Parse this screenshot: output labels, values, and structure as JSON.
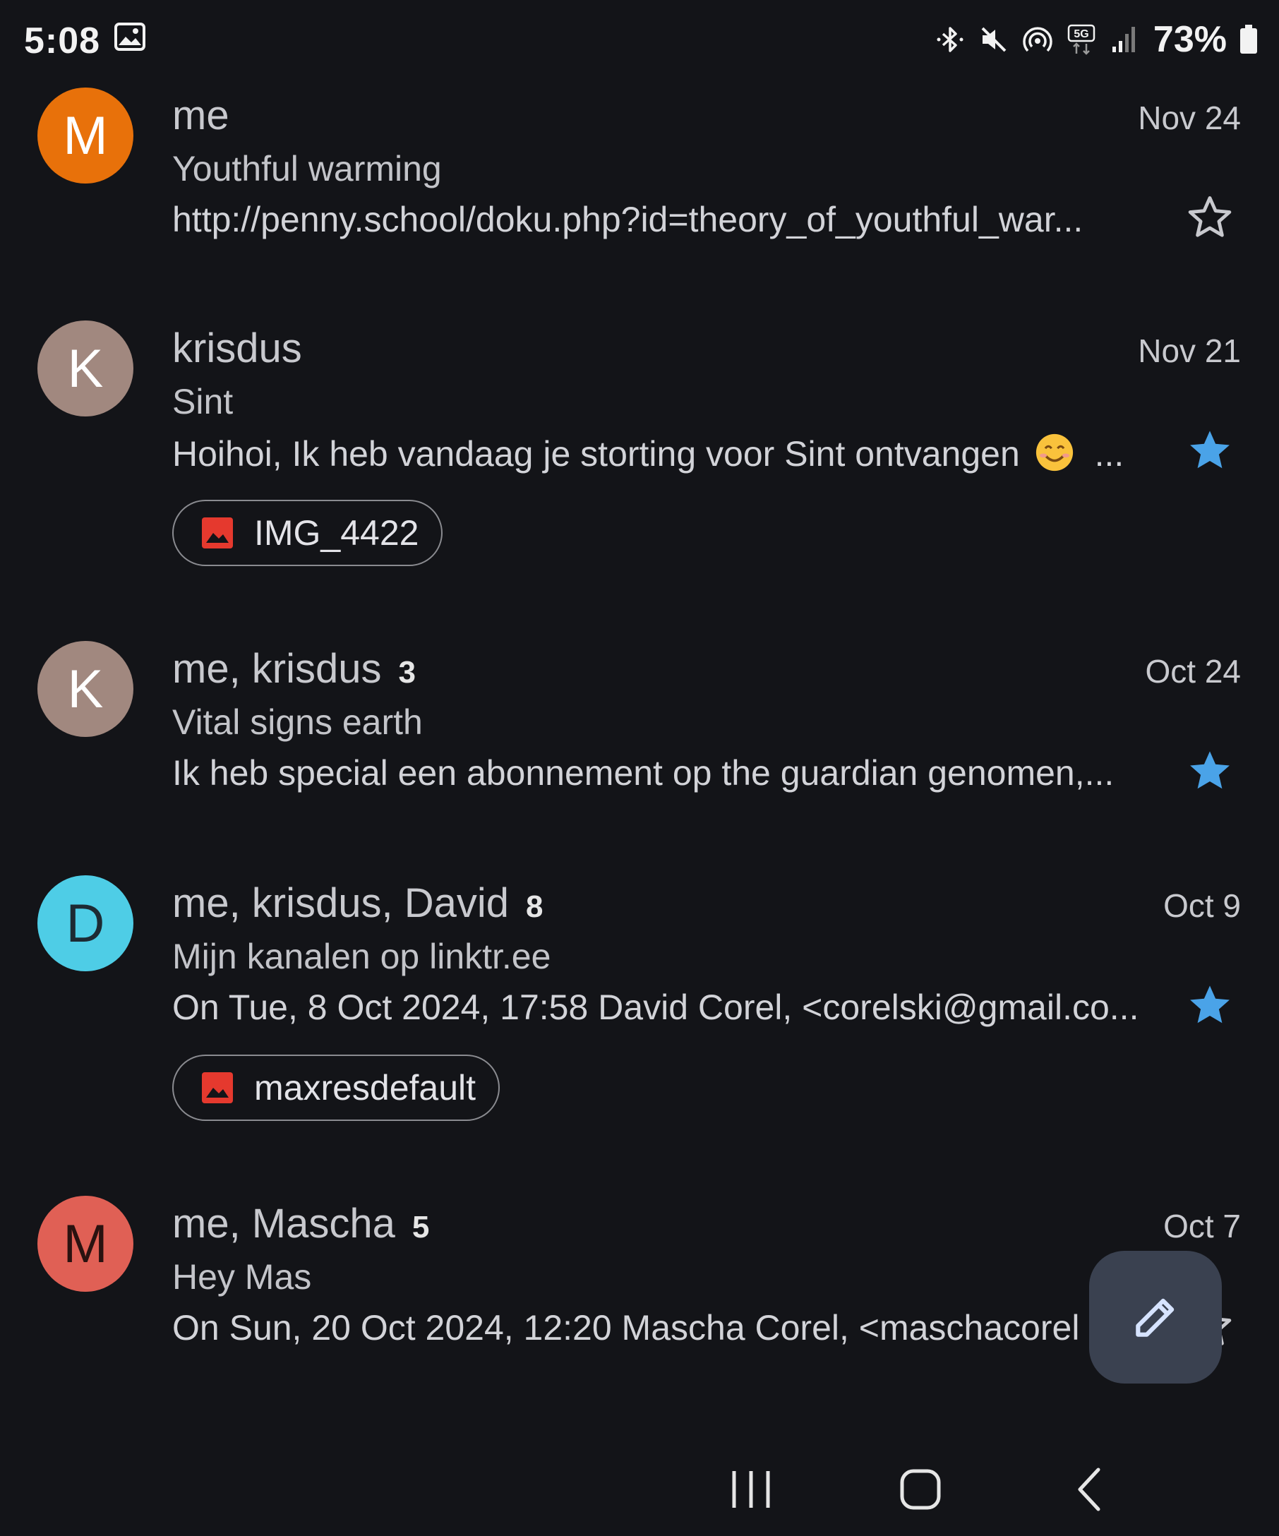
{
  "status_bar": {
    "time": "5:08",
    "battery_percent": "73%",
    "icons": [
      "gallery-icon",
      "bluetooth-icon",
      "mute-icon",
      "hotspot-icon",
      "5g-icon",
      "signal-icon",
      "battery-icon"
    ]
  },
  "mails": [
    {
      "avatar_letter": "M",
      "avatar_color": "#e8710a",
      "sender": "me",
      "count": "",
      "date": "Nov 24",
      "subject": "Youthful warming",
      "snippet": "http://penny.school/doku.php?id=theory_of_youthful_war...",
      "starred": false,
      "attachment": ""
    },
    {
      "avatar_letter": "K",
      "avatar_color": "#a1887f",
      "sender": "krisdus",
      "count": "",
      "date": "Nov 21",
      "subject": "Sint",
      "snippet": "Hoihoi, Ik heb vandaag je storting voor Sint ontvangen",
      "snippet_suffix": "...",
      "starred": true,
      "attachment": "IMG_4422"
    },
    {
      "avatar_letter": "K",
      "avatar_color": "#a1887f",
      "sender": "me, krisdus",
      "count": "3",
      "date": "Oct 24",
      "subject": "Vital signs earth",
      "snippet": "Ik heb special een abonnement op the guardian genomen,...",
      "starred": true,
      "attachment": ""
    },
    {
      "avatar_letter": "D",
      "avatar_color": "#4ecde6",
      "sender": "me, krisdus, David",
      "count": "8",
      "date": "Oct 9",
      "subject": "Mijn kanalen op linktr.ee",
      "snippet": "On Tue, 8 Oct 2024, 17:58 David Corel, <corelski@gmail.co...",
      "starred": true,
      "attachment": "maxresdefault"
    },
    {
      "avatar_letter": "M",
      "avatar_color": "#e06055",
      "sender": "me, Mascha",
      "count": "5",
      "date": "Oct 7",
      "subject": "Hey Mas",
      "snippet": "On Sun, 20 Oct 2024, 12:20 Mascha Corel, <maschacorel",
      "starred": false,
      "attachment": ""
    }
  ],
  "colors": {
    "background": "#131418",
    "star_active": "#4aa3e8",
    "fab_background": "#3a4150",
    "attachment_icon": "#e5392e"
  },
  "fab": {
    "icon": "pencil-icon"
  },
  "nav_bar": {
    "icons": [
      "recent-apps-icon",
      "home-icon",
      "back-icon"
    ]
  }
}
